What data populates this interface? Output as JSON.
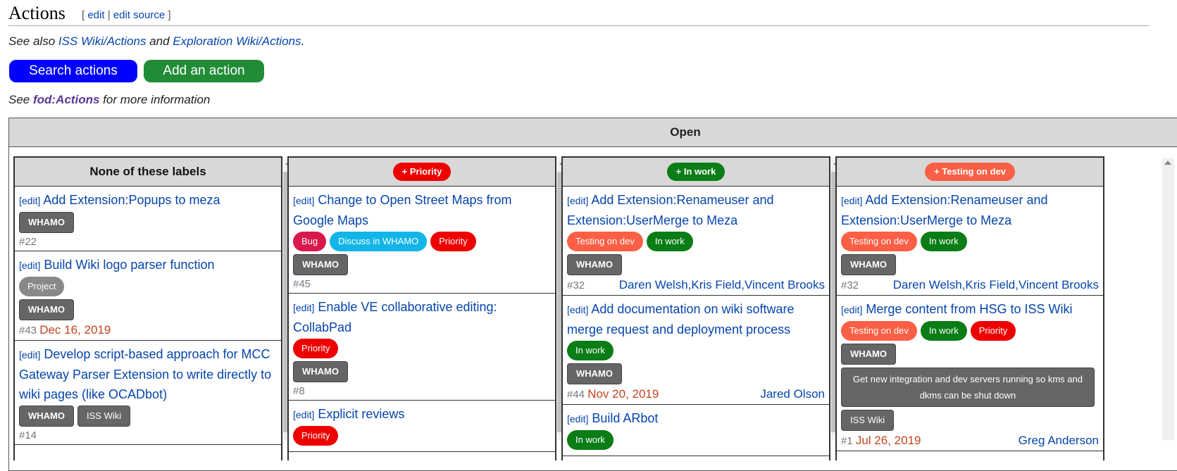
{
  "section": {
    "title": "Actions",
    "edit_open": "[",
    "edit": "edit",
    "sep": "|",
    "edit_source": "edit source",
    "edit_close": "]"
  },
  "see_also": {
    "prefix": "See also",
    "link1": "ISS Wiki/Actions",
    "mid": "and",
    "link2": "Exploration Wiki/Actions",
    "suffix": "."
  },
  "buttons": {
    "search": "Search actions",
    "add": "Add an action"
  },
  "see_more": {
    "prefix": "See",
    "link": "fod:Actions",
    "suffix": "for more information"
  },
  "board": {
    "group_title": "Open"
  },
  "colors": {
    "priority": "#ee0000",
    "in_work": "#0a7d16",
    "testing": "#fb5f45",
    "bug": "#d9184c",
    "discuss": "#12b5e8",
    "project": "#888888",
    "whamo": "#666666"
  },
  "columns": [
    {
      "header": "None of these labels",
      "cards": [
        {
          "edit": "[edit]",
          "title": "Add Extension:Popups to meza",
          "tags": [],
          "boxes": [
            "WHAMO"
          ],
          "id": "#22",
          "date": "",
          "people": ""
        },
        {
          "edit": "[edit]",
          "title": "Build Wiki logo parser function",
          "tags": [
            "Project"
          ],
          "boxes": [
            "WHAMO"
          ],
          "id": "#43",
          "date": "Dec 16, 2019",
          "people": ""
        },
        {
          "edit": "[edit]",
          "title": "Develop script-based approach for MCC Gateway Parser Extension to write directly to wiki pages (like OCADbot)",
          "tags": [],
          "boxes": [
            "WHAMO",
            "ISS Wiki"
          ],
          "id": "#14",
          "date": "",
          "people": ""
        }
      ]
    },
    {
      "header": "+ Priority",
      "cards": [
        {
          "edit": "[edit]",
          "title": "Change to Open Street Maps from Google Maps",
          "tags": [
            "Bug",
            "Discuss in WHAMO",
            "Priority"
          ],
          "boxes": [
            "WHAMO"
          ],
          "id": "#45",
          "date": "",
          "people": ""
        },
        {
          "edit": "[edit]",
          "title": "Enable VE collaborative editing: CollabPad",
          "tags": [
            "Priority"
          ],
          "boxes": [
            "WHAMO"
          ],
          "id": "#8",
          "date": "",
          "people": ""
        },
        {
          "edit": "[edit]",
          "title": "Explicit reviews",
          "tags": [
            "Priority"
          ],
          "boxes": [],
          "id": "",
          "date": "",
          "people": ""
        }
      ]
    },
    {
      "header": "+ In work",
      "cards": [
        {
          "edit": "[edit]",
          "title": "Add Extension:Renameuser and Extension:UserMerge to Meza",
          "tags": [
            "Testing on dev",
            "In work"
          ],
          "boxes": [
            "WHAMO"
          ],
          "id": "#32",
          "date": "",
          "people": "Daren Welsh,Kris Field,Vincent Brooks"
        },
        {
          "edit": "[edit]",
          "title": "Add documentation on wiki software merge request and deployment process",
          "tags": [
            "In work"
          ],
          "boxes": [
            "WHAMO"
          ],
          "id": "#44",
          "date": "Nov 20, 2019",
          "people": "Jared Olson"
        },
        {
          "edit": "[edit]",
          "title": "Build ARbot",
          "tags": [
            "In work"
          ],
          "boxes": [],
          "id": "",
          "date": "",
          "people": ""
        }
      ]
    },
    {
      "header": "+ Testing on dev",
      "cards": [
        {
          "edit": "[edit]",
          "title": "Add Extension:Renameuser and Extension:UserMerge to Meza",
          "tags": [
            "Testing on dev",
            "In work"
          ],
          "boxes": [
            "WHAMO"
          ],
          "id": "#32",
          "date": "",
          "people": "Daren Welsh,Kris Field,Vincent Brooks"
        },
        {
          "edit": "[edit]",
          "title": "Merge content from HSG to ISS Wiki",
          "tags": [
            "Testing on dev",
            "In work",
            "Priority"
          ],
          "boxes": [
            "WHAMO"
          ],
          "note": "Get new integration and dev servers running so kms and dkms can be shut down",
          "boxes_after": [
            "ISS Wiki"
          ],
          "id": "#1",
          "date": "Jul 26, 2019",
          "people": "Greg Anderson"
        }
      ]
    }
  ]
}
